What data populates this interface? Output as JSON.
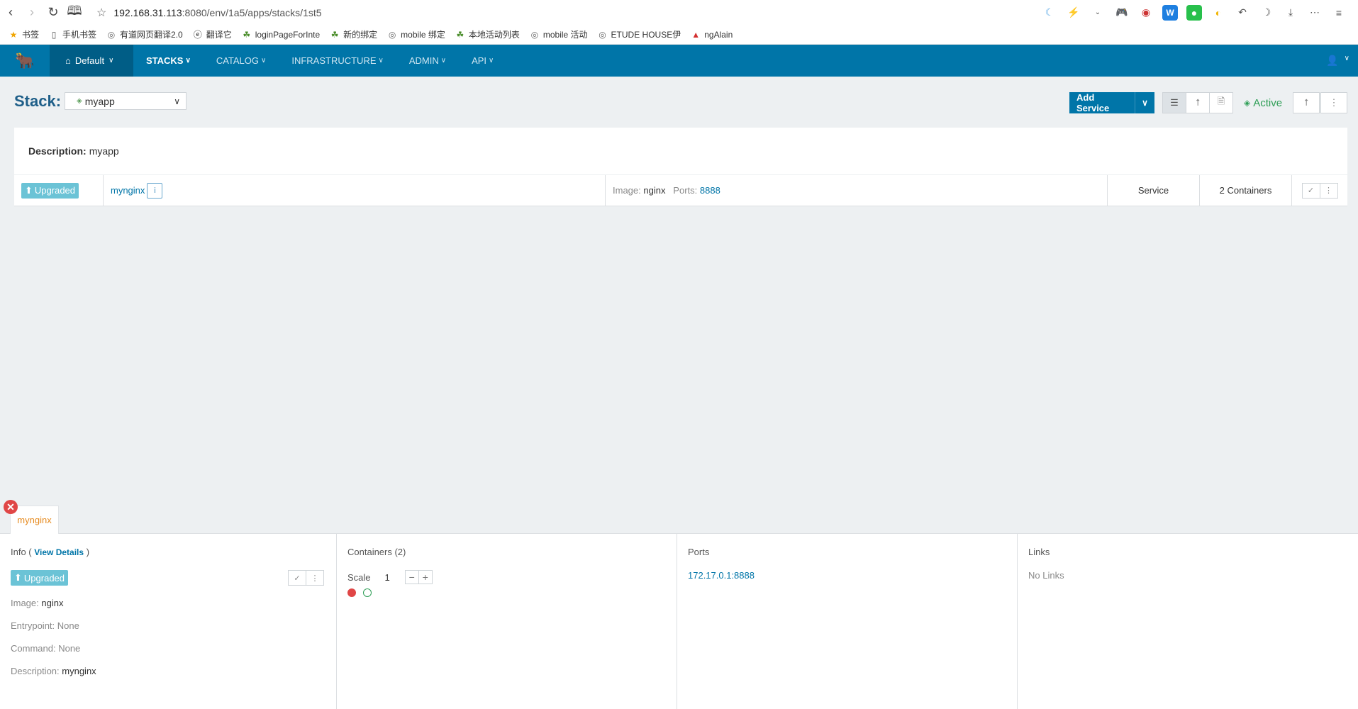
{
  "browser": {
    "url_host": "192.168.31.113",
    "url_path": ":8080/env/1a5/apps/stacks/1st5"
  },
  "bookmarks": [
    {
      "label": "书签",
      "icon": "star-icon"
    },
    {
      "label": "手机书签",
      "icon": "phone-icon"
    },
    {
      "label": "有道网页翻译2.0",
      "icon": "globe-icon"
    },
    {
      "label": "翻译它",
      "icon": "e-icon"
    },
    {
      "label": "loginPageForInte",
      "icon": "leaf-icon"
    },
    {
      "label": "新的绑定",
      "icon": "leaf-icon"
    },
    {
      "label": "mobile 绑定",
      "icon": "globe-icon"
    },
    {
      "label": "本地活动列表",
      "icon": "leaf-icon"
    },
    {
      "label": "mobile 活动",
      "icon": "globe-icon"
    },
    {
      "label": "ETUDE HOUSE伊",
      "icon": "globe-icon"
    },
    {
      "label": "ngAlain",
      "icon": "angular-icon"
    }
  ],
  "nav": {
    "env": "Default",
    "items": [
      "STACKS",
      "CATALOG",
      "INFRASTRUCTURE",
      "ADMIN",
      "API"
    ]
  },
  "stack": {
    "title": "Stack:",
    "selected": "myapp",
    "add_service": "Add Service",
    "state": "Active",
    "description_label": "Description:",
    "description_value": "myapp"
  },
  "service": {
    "state": "Upgraded",
    "name": "mynginx",
    "image_label": "Image:",
    "image": "nginx",
    "ports_label": "Ports:",
    "ports": "8888",
    "type": "Service",
    "containers": "2 Containers"
  },
  "panel": {
    "tab": "mynginx",
    "info_title": "Info (",
    "view_details": "View Details",
    "info_close": ")",
    "state": "Upgraded",
    "image_label": "Image:",
    "image": "nginx",
    "entrypoint_label": "Entrypoint:",
    "entrypoint": "None",
    "command_label": "Command:",
    "command": "None",
    "description_label": "Description:",
    "description": "mynginx",
    "containers_title": "Containers (2)",
    "scale_label": "Scale",
    "scale_value": "1",
    "ports_title": "Ports",
    "port_value": "172.17.0.1:8888",
    "links_title": "Links",
    "links_value": "No Links"
  },
  "colors": {
    "primary": "#0075a8",
    "active": "#2e9e56",
    "upgraded": "#6bc3d6",
    "tab": "#e68a1e"
  }
}
